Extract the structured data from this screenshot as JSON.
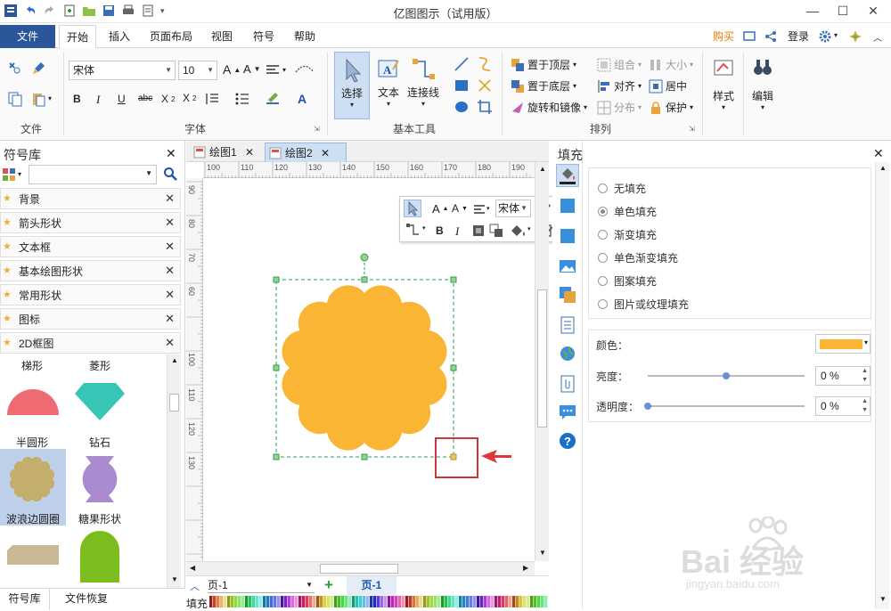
{
  "app": {
    "title": "亿图图示（试用版）",
    "window_controls": [
      "minimize-icon",
      "maximize-icon",
      "close-icon"
    ]
  },
  "ribbon_tabs": {
    "file": "文件",
    "items": [
      "开始",
      "插入",
      "页面布局",
      "视图",
      "符号",
      "帮助"
    ],
    "active": "开始",
    "right": {
      "buy": "购买",
      "login": "登录"
    }
  },
  "ribbon": {
    "file_group_label": "文件",
    "font": {
      "name": "宋体",
      "size": "10",
      "group_label": "字体"
    },
    "basic_tools": {
      "select": "选择",
      "text": "文本",
      "connector": "连接线",
      "group_label": "基本工具"
    },
    "arrange": {
      "bring_front": "置于顶层",
      "send_back": "置于底层",
      "rotate": "旋转和镜像",
      "group": "组合",
      "align": "对齐",
      "distribute": "分布",
      "size": "大小",
      "center": "居中",
      "protect": "保护",
      "group_label": "排列"
    },
    "style": "样式",
    "edit": "编辑"
  },
  "left_panel": {
    "title": "符号库",
    "libraries": [
      "背景",
      "箭头形状",
      "文本框",
      "基本绘图形状",
      "常用形状",
      "图标",
      "2D框图"
    ],
    "shapes": [
      {
        "label": "梯形",
        "color": "#ef6b72"
      },
      {
        "label": "菱形",
        "color": "#35c6b6"
      },
      {
        "label": "半圆形",
        "color": "#ef6b72"
      },
      {
        "label": "钻石",
        "color": "#35c6b6"
      },
      {
        "label": "波浪边圆圈",
        "color": "#c4ae6c",
        "selected": true
      },
      {
        "label": "糖果形状",
        "color": "#a98ccf"
      },
      {
        "label": "",
        "color": "#c9b894"
      },
      {
        "label": "",
        "color": "#7cbd1e"
      }
    ],
    "bottom_tabs": [
      "符号库",
      "文件恢复"
    ]
  },
  "documents": {
    "tabs": [
      "绘图1",
      "绘图2"
    ],
    "active": "绘图2"
  },
  "ruler": {
    "h_ticks": [
      "100",
      "110",
      "120",
      "130",
      "140",
      "150",
      "160",
      "170",
      "180",
      "190"
    ],
    "v_ticks": [
      "90",
      "80",
      "70",
      "60",
      "100",
      "110",
      "120",
      "130"
    ]
  },
  "floating_toolbar": {
    "font": "宋体"
  },
  "canvas": {
    "shape_fill": "#fbb534"
  },
  "page_bar": {
    "page_select": "页-1",
    "page_tab": "页-1"
  },
  "color_bar": {
    "label": "填充"
  },
  "fill_panel": {
    "title": "填充",
    "options": [
      "无填充",
      "单色填充",
      "渐变填充",
      "单色渐变填充",
      "图案填充",
      "图片或纹理填充"
    ],
    "selected": "单色填充",
    "color_label": "颜色：",
    "color_value": "#fbb534",
    "brightness_label": "亮度：",
    "brightness_value": "0 %",
    "brightness_level": 0.5,
    "transparency_label": "透明度：",
    "transparency_value": "0 %",
    "transparency_level": 0
  },
  "watermark": {
    "brand": "Bai 经验",
    "url": "jingyan.baidu.com"
  }
}
